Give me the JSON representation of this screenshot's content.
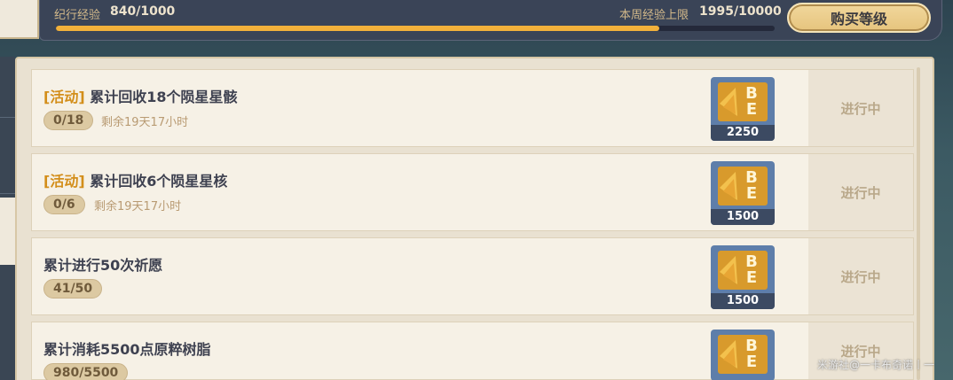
{
  "header": {
    "exp_label": "纪行经验",
    "exp_value": "840/1000",
    "exp_fraction": 0.84,
    "week_label": "本周经验上限",
    "week_value": "1995/10000",
    "buy_button": "购买等级"
  },
  "tasks": [
    {
      "tag": "[活动]",
      "title": "累计回收18个陨星星骸",
      "progress": "0/18",
      "remaining": "剩余19天17小时",
      "reward": "2250",
      "status": "进行中"
    },
    {
      "tag": "[活动]",
      "title": "累计回收6个陨星星核",
      "progress": "0/6",
      "remaining": "剩余19天17小时",
      "reward": "1500",
      "status": "进行中"
    },
    {
      "tag": "",
      "title": "累计进行50次祈愿",
      "progress": "41/50",
      "remaining": "",
      "reward": "1500",
      "status": "进行中"
    },
    {
      "tag": "",
      "title": "累计消耗5500点原粹树脂",
      "progress": "980/5500",
      "remaining": "",
      "reward": "",
      "status": "进行中"
    }
  ],
  "watermark": "米游社@一卡布奇诺丨一",
  "colors": {
    "accent_gold": "#f2b13b",
    "tag_orange": "#d38e1a",
    "reward_blue": "#5e7eaa"
  },
  "icons": {
    "reward": "battle-pass-exp-icon"
  }
}
